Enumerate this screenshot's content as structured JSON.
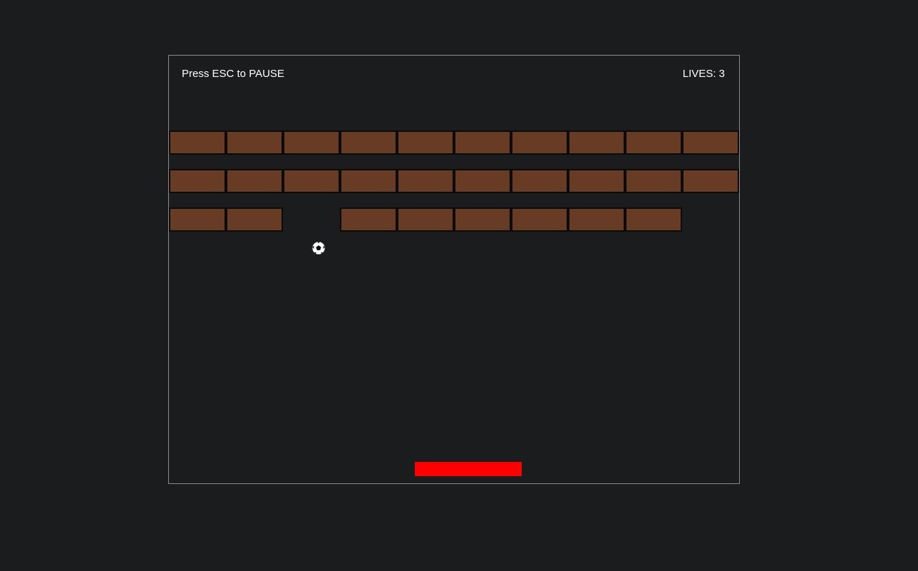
{
  "hud": {
    "pause_hint": "Press ESC to PAUSE",
    "lives_label": "LIVES: 3",
    "lives": 3
  },
  "colors": {
    "background": "#1b1c1e",
    "board_border": "#8a8a8a",
    "brick": "#683c24",
    "brick_border": "#0b0b0b",
    "paddle": "#ff0000",
    "ball_primary": "#ffffff",
    "ball_patch": "#111111"
  },
  "bricks": {
    "columns": 10,
    "rows": [
      [
        1,
        1,
        1,
        1,
        1,
        1,
        1,
        1,
        1,
        1
      ],
      [
        1,
        1,
        1,
        1,
        1,
        1,
        1,
        1,
        1,
        1
      ],
      [
        1,
        1,
        0,
        1,
        1,
        1,
        1,
        1,
        1,
        0
      ]
    ]
  },
  "ball": {
    "icon": "soccer-ball-icon"
  },
  "paddle": {
    "name": "paddle"
  }
}
